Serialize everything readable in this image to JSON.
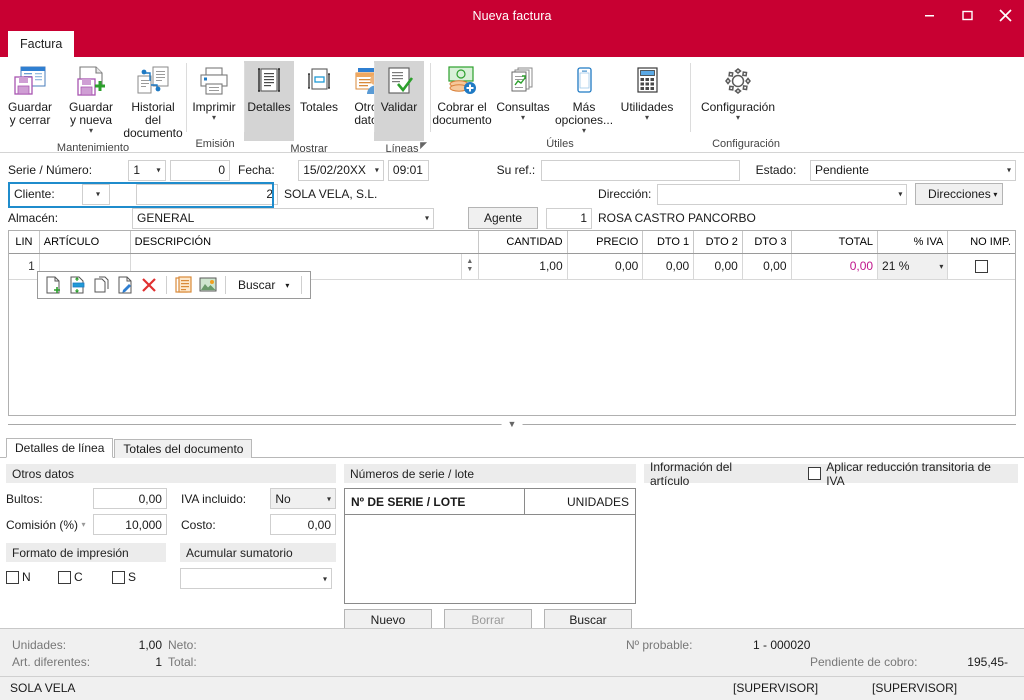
{
  "window": {
    "title": "Nueva factura",
    "minimize_icon": "minimize-icon",
    "maximize_icon": "maximize-icon",
    "close_icon": "close-icon",
    "accent_color": "#c80032"
  },
  "ribbon": {
    "tab_label": "Factura",
    "groups": [
      {
        "name": "mantenimiento",
        "label": "Mantenimiento",
        "buttons": [
          {
            "name": "guardar-y-cerrar",
            "label": "Guardar\ny cerrar",
            "icon": "save-close-icon",
            "caret": false,
            "selected": false
          },
          {
            "name": "guardar-y-nueva",
            "label": "Guardar\ny nueva",
            "icon": "save-new-icon",
            "caret": true,
            "selected": false
          },
          {
            "name": "historial-del-documento",
            "label": "Historial del\ndocumento",
            "icon": "document-history-icon",
            "caret": false,
            "selected": false
          }
        ]
      },
      {
        "name": "emision",
        "label": "Emisión",
        "buttons": [
          {
            "name": "imprimir",
            "label": "Imprimir",
            "icon": "printer-icon",
            "caret": true,
            "selected": false
          }
        ]
      },
      {
        "name": "mostrar",
        "label": "Mostrar",
        "buttons": [
          {
            "name": "detalles",
            "label": "Detalles",
            "icon": "details-icon",
            "caret": false,
            "selected": true
          },
          {
            "name": "totales",
            "label": "Totales",
            "icon": "totals-icon",
            "caret": false,
            "selected": false
          },
          {
            "name": "otros-datos",
            "label": "Otros\ndatos",
            "icon": "other-data-icon",
            "caret": false,
            "selected": false
          }
        ]
      },
      {
        "name": "lineas",
        "label": "Líneas",
        "dialog_launcher": true,
        "buttons": [
          {
            "name": "validar",
            "label": "Validar",
            "icon": "validate-icon",
            "caret": false,
            "selected": true
          }
        ]
      },
      {
        "name": "utiles",
        "label": "Útiles",
        "buttons": [
          {
            "name": "cobrar-el-documento",
            "label": "Cobrar el\ndocumento",
            "icon": "money-collect-icon",
            "caret": false,
            "selected": false
          },
          {
            "name": "consultas",
            "label": "Consultas",
            "icon": "reports-icon",
            "caret": true,
            "selected": false
          },
          {
            "name": "mas-opciones",
            "label": "Más\nopciones...",
            "icon": "mobile-icon",
            "caret": true,
            "selected": false
          },
          {
            "name": "utilidades",
            "label": "Utilidades",
            "icon": "calculator-icon",
            "caret": true,
            "selected": false
          }
        ]
      },
      {
        "name": "configuracion",
        "label": "Configuración",
        "buttons": [
          {
            "name": "configuracion",
            "label": "Configuración",
            "icon": "gear-icon",
            "caret": true,
            "selected": false
          }
        ]
      }
    ]
  },
  "header_form": {
    "serie_numero_label": "Serie / Número:",
    "serie_value": "1",
    "numero_value": "0",
    "fecha_label": "Fecha:",
    "fecha_value": "15/02/20XX",
    "hora_value": "09:01",
    "su_ref_label": "Su ref.:",
    "su_ref_value": "",
    "estado_label": "Estado:",
    "estado_value": "Pendiente",
    "cliente_label": "Cliente:",
    "cliente_code": "2",
    "cliente_name": "SOLA VELA, S.L.",
    "direccion_label": "Dirección:",
    "direccion_value": "",
    "direcciones_button": "Direcciones",
    "almacen_label": "Almacén:",
    "almacen_value": "GENERAL",
    "agente_button": "Agente",
    "agente_code": "1",
    "agente_name": "ROSA CASTRO PANCORBO"
  },
  "grid": {
    "columns": [
      "LIN",
      "ARTÍCULO",
      "DESCRIPCIÓN",
      "CANTIDAD",
      "PRECIO",
      "DTO 1",
      "DTO 2",
      "DTO 3",
      "TOTAL",
      "% IVA",
      "NO IMP."
    ],
    "rows": [
      {
        "lin": "1",
        "articulo": "",
        "descripcion": "",
        "cantidad": "1,00",
        "precio": "0,00",
        "dto1": "0,00",
        "dto2": "0,00",
        "dto3": "0,00",
        "total": "0,00",
        "iva": "21 %",
        "no_imp": false
      }
    ],
    "total_color": "#c0158c",
    "toolbar": {
      "buttons": [
        {
          "name": "nueva-linea-icon",
          "icon": "new-line-icon"
        },
        {
          "name": "insertar-linea-icon",
          "icon": "insert-line-icon"
        },
        {
          "name": "copiar-linea-icon",
          "icon": "copy-line-icon"
        },
        {
          "name": "editar-linea-icon",
          "icon": "edit-line-icon"
        },
        {
          "name": "eliminar-linea-icon",
          "icon": "delete-line-icon"
        },
        {
          "name": "texto-icon",
          "icon": "text-note-icon"
        },
        {
          "name": "imagen-icon",
          "icon": "image-icon"
        }
      ],
      "search_label": "Buscar"
    }
  },
  "bottom_tabs": [
    {
      "name": "tab-detalles-de-linea",
      "label": "Detalles de línea",
      "active": true
    },
    {
      "name": "tab-totales-del-documento",
      "label": "Totales del documento",
      "active": false
    }
  ],
  "panel_otros_datos": {
    "section_title": "Otros datos",
    "bultos_label": "Bultos:",
    "bultos_value": "0,00",
    "iva_incluido_label": "IVA incluido:",
    "iva_incluido_value": "No",
    "comision_label": "Comisión (%)",
    "comision_value": "10,000",
    "costo_label": "Costo:",
    "costo_value": "0,00",
    "formato_impresion_title": "Formato de impresión",
    "formato_options": [
      {
        "name": "formato-n",
        "label": "N",
        "checked": false
      },
      {
        "name": "formato-c",
        "label": "C",
        "checked": false
      },
      {
        "name": "formato-s",
        "label": "S",
        "checked": false
      }
    ],
    "acumular_title": "Acumular sumatorio",
    "acumular_value": ""
  },
  "panel_series": {
    "section_title": "Números de serie / lote",
    "col_serie": "Nº DE SERIE / LOTE",
    "col_unidades": "UNIDADES",
    "rows": [],
    "btn_nuevo": "Nuevo",
    "btn_borrar": "Borrar",
    "btn_buscar": "Buscar"
  },
  "panel_articulo": {
    "section_title": "Información del artículo",
    "checkbox_label": "Aplicar reducción transitoria de IVA",
    "checkbox_checked": false
  },
  "status": {
    "unidades_label": "Unidades:",
    "unidades_value": "1,00",
    "neto_label": "Neto:",
    "neto_value": "",
    "art_diferentes_label": "Art. diferentes:",
    "art_diferentes_value": "1",
    "total_label": "Total:",
    "total_value": "",
    "n_probable_label": "Nº probable:",
    "n_probable_value": "1 - 000020",
    "pendiente_cobro_label": "Pendiente de cobro:",
    "pendiente_cobro_value": "195,45-",
    "company": "SOLA VELA",
    "user_left": "[SUPERVISOR]",
    "user_right": "[SUPERVISOR]"
  }
}
